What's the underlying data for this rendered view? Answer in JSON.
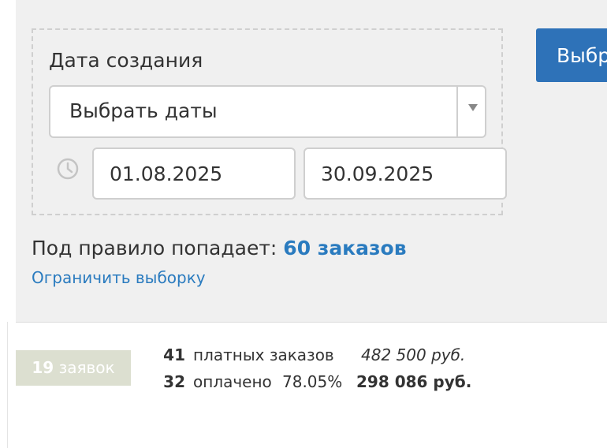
{
  "filter": {
    "label": "Дата создания",
    "select_value": "Выбрать даты",
    "date_from": "01.08.2025",
    "date_to": "30.09.2025",
    "icons": {
      "clock": "clock-icon",
      "dropdown": "chevron-down-icon"
    }
  },
  "rule": {
    "prefix": "Под правило попадает:",
    "count": "60 заказов",
    "limit_link": "Ограничить выборку"
  },
  "primary_button": {
    "label": "Выбр"
  },
  "summary": {
    "requests_count": "19",
    "requests_label": "заявок",
    "paid_count": "41",
    "paid_label": "платных заказов",
    "paid_amount": "482 500 руб.",
    "settled_count": "32",
    "settled_label": "оплачено",
    "settled_percent": "78.05%",
    "settled_amount": "298 086 руб."
  },
  "colors": {
    "accent": "#2a7bbf",
    "button": "#2e72b8",
    "badge": "#dcdfd0",
    "panel": "#f0f0f0"
  }
}
